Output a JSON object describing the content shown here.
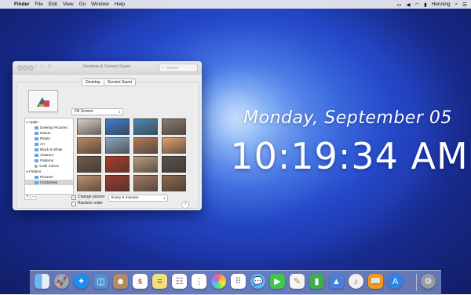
{
  "menubar": {
    "apple": "",
    "items": [
      "Finder",
      "File",
      "Edit",
      "View",
      "Go",
      "Window",
      "Help"
    ],
    "user": "Henning",
    "status_icons": [
      "airplay-icon",
      "volume-icon",
      "wifi-icon",
      "battery-icon",
      "search-icon",
      "notification-center-icon"
    ]
  },
  "clock": {
    "date": "Monday, September 05",
    "time": "10:19:34 AM"
  },
  "window": {
    "title": "Desktop & Screen Saver",
    "search_placeholder": "Search",
    "tabs": [
      "Desktop",
      "Screen Saver"
    ],
    "selected_tab": "Desktop",
    "fill_mode": "Fill Screen",
    "sidebar": {
      "groups": [
        {
          "label": "Apple",
          "items": [
            "Desktop Pictures",
            "Nature",
            "Plants",
            "Art",
            "Black & White",
            "Abstract",
            "Patterns",
            "Solid Colors"
          ]
        },
        {
          "label": "Folders",
          "items": [
            "Pictures",
            "ClockDesk"
          ]
        }
      ],
      "selected": "ClockDesk",
      "add_label": "+",
      "remove_label": "−"
    },
    "change_picture": {
      "label": "Change picture:",
      "checked": true,
      "interval": "Every 5 minutes"
    },
    "random_order": {
      "label": "Random order",
      "checked": false
    },
    "help_label": "?"
  },
  "thumbnail_colors": [
    [
      "#d8d0c6",
      "#3e7fd0",
      "#4a8ab8",
      "#8a7a70"
    ],
    [
      "#b58a62",
      "#8aa6c0",
      "#b07a5a",
      "#e0a070"
    ],
    [
      "#6e5a44",
      "#b03a28",
      "#b89a7c",
      "#5a5048"
    ],
    [
      "#c09070",
      "#9a3a30",
      "#a07a68",
      "#8a6a50"
    ]
  ],
  "dock": [
    "finder",
    "launchpad",
    "safari",
    "preview",
    "contacts",
    "calendar",
    "notes",
    "reminders",
    "photos",
    "messages",
    "facetime",
    "pages",
    "numbers",
    "keynote",
    "itunes",
    "ibooks",
    "app-store",
    "system-preferences",
    "trash"
  ]
}
